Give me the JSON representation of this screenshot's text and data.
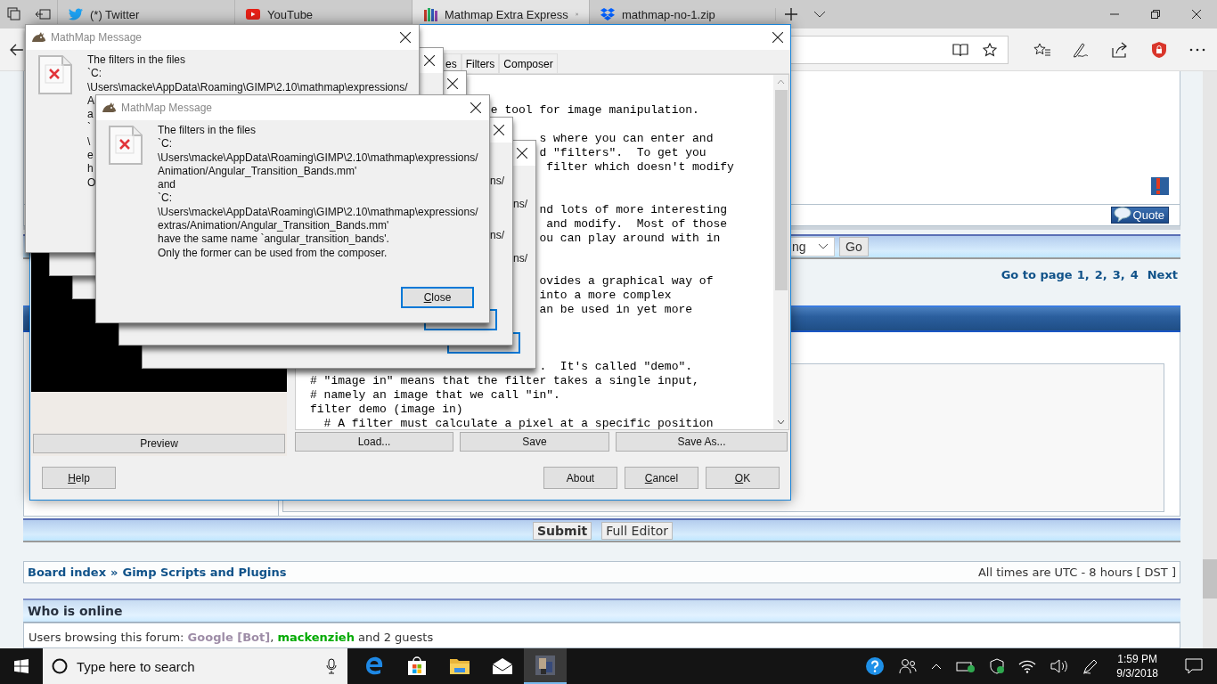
{
  "browser": {
    "tabs": [
      {
        "title": "(*) Twitter",
        "kind": "twitter",
        "selected": false
      },
      {
        "title": "YouTube",
        "kind": "youtube",
        "selected": false
      },
      {
        "title": "Mathmap Extra Express",
        "kind": "forum",
        "selected": true
      },
      {
        "title": "mathmap-no-1.zip",
        "kind": "dropbox",
        "selected": false
      }
    ]
  },
  "forum": {
    "quote_button": "Quote",
    "sort_select": {
      "value": "ng"
    },
    "go_button": "Go",
    "pagination": {
      "label": "Go to page",
      "pages": [
        "1",
        "2",
        "3",
        "4"
      ],
      "separator": ",",
      "next": "Next"
    },
    "submit_button": "Submit",
    "full_editor_button": "Full Editor",
    "breadcrumb": {
      "items": [
        "Board index",
        "Gimp Scripts and Plugins"
      ],
      "separator": "»"
    },
    "timezone": "All times are UTC - 8 hours [ DST ]",
    "who_is_online": {
      "title": "Who is online",
      "parts": [
        {
          "text": "Users browsing this forum: ",
          "kind": "plain"
        },
        {
          "text": "Google [Bot]",
          "kind": "bot"
        },
        {
          "text": ", ",
          "kind": "plain"
        },
        {
          "text": "mackenzieh",
          "kind": "user"
        },
        {
          "text": " and 2 guests",
          "kind": "plain"
        }
      ]
    }
  },
  "mathmap": {
    "tabs": [
      {
        "label": "es",
        "selected": false
      },
      {
        "label": "Filters",
        "selected": false
      },
      {
        "label": "Composer",
        "selected": false
      }
    ],
    "code_lines": [
      "e tool for image manipulation.",
      "s where you can enter and",
      "d \"filters\".  To get you",
      "filter which doesn't modify",
      "nd lots of more interesting",
      "and modify.  Most of those",
      "ou can play around with in",
      "ovides a graphical way of",
      "into a more complex",
      "an be used in yet more",
      ".  It's called \"demo\".",
      "# \"image in\" means that the filter takes a single input,",
      "# namely an image that we call \"in\".",
      "filter demo (image in)",
      "  # A filter must calculate a pixel at a specific position"
    ],
    "preview_button": "Preview",
    "file_buttons": [
      "Load...",
      "Save",
      "Save As..."
    ],
    "help_button": {
      "label": "Help",
      "mnemonic": true
    },
    "buttons": [
      {
        "label": "About",
        "mnemonic": false
      },
      {
        "label": "Cancel",
        "mnemonic": true
      },
      {
        "label": "OK",
        "mnemonic": true
      }
    ]
  },
  "messages": [
    {
      "kind": "covered",
      "title": "MathMap Message",
      "lines": [
        "The filters in the files",
        "`C:",
        "\\Users\\macke\\AppData\\Roaming\\GIMP\\2.10\\mathmap\\expressions/",
        "A",
        "a",
        "`",
        "\\",
        "e",
        "h",
        "O"
      ]
    },
    {
      "kind": "edge"
    },
    {
      "kind": "edge"
    },
    {
      "kind": "full",
      "title": "MathMap Message",
      "lines": [
        "The filters in the files",
        "`C:",
        "\\Users\\macke\\AppData\\Roaming\\GIMP\\2.10\\mathmap\\expressions/",
        "Animation/Angular_Transition_Bands.mm'",
        "and",
        "`C:",
        "\\Users\\macke\\AppData\\Roaming\\GIMP\\2.10\\mathmap\\expressions/",
        "extras/Animation/Angular_Transition_Bands.mm'",
        "have the same name `angular_transition_bands'.",
        "Only the former can be used from the composer."
      ],
      "close_button": {
        "label": "Close",
        "mnemonic": true
      }
    },
    {
      "kind": "tail",
      "fragments": [
        "ns/",
        "ns/"
      ]
    },
    {
      "kind": "tail",
      "fragments": [
        "ns/",
        "ns/"
      ]
    }
  ],
  "taskbar": {
    "search_placeholder": "Type here to search",
    "time": "1:59 PM",
    "date": "9/3/2018"
  }
}
